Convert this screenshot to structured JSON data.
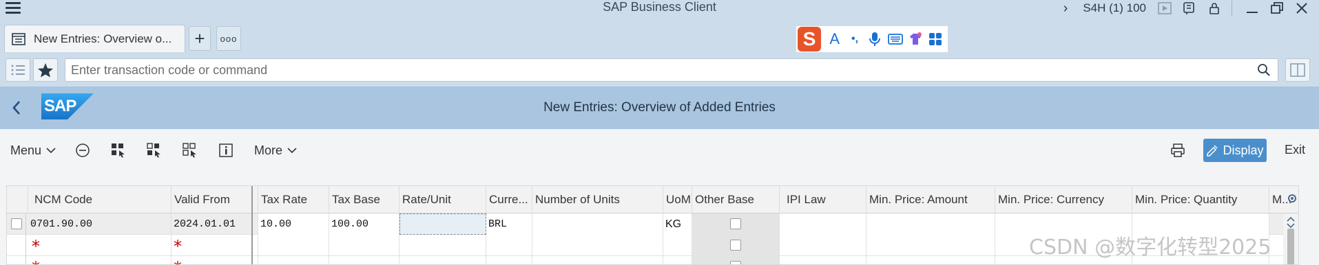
{
  "window": {
    "app_title": "SAP Business Client",
    "system_info": "S4H (1) 100"
  },
  "tabs": {
    "active_label": "New Entries: Overview o...",
    "add_symbol": "+",
    "more_symbol": "ooo"
  },
  "ime": {
    "logo": "S",
    "text_tool": "A",
    "punct_tool": "•,"
  },
  "command": {
    "placeholder": "Enter transaction code or command"
  },
  "header": {
    "logo_text": "SAP",
    "title": "New Entries: Overview of Added Entries"
  },
  "toolbar": {
    "menu_label": "Menu",
    "more_label": "More",
    "display_label": "Display",
    "exit_label": "Exit"
  },
  "table": {
    "columns": [
      "NCM Code",
      "Valid From",
      "Tax Rate",
      "Tax Base",
      "Rate/Unit",
      "Curre...",
      "Number of Units",
      "UoM",
      "Other Base",
      "IPI Law",
      "Min. Price: Amount",
      "Min. Price: Currency",
      "Min. Price: Quantity",
      "M..."
    ],
    "rows": [
      {
        "ncm": "0701.90.00",
        "valid_from": "2024.01.01",
        "tax_rate": "10.00",
        "tax_base": "100.00",
        "rate_unit": "",
        "currency": "BRL",
        "units": "",
        "uom": "KG",
        "ipi_law": "",
        "min_amount": "",
        "min_currency": "",
        "min_quantity": ""
      },
      {
        "ncm_required": "*",
        "valid_required": "*"
      },
      {
        "ncm_required": "*",
        "valid_required": "*"
      }
    ]
  },
  "watermark": "CSDN @数字化转型2025",
  "colors": {
    "shell_blue": "#a9c5e0",
    "titlebar": "#ccdcea",
    "accent_button": "#4a8fcc",
    "required": "#cc0000"
  }
}
